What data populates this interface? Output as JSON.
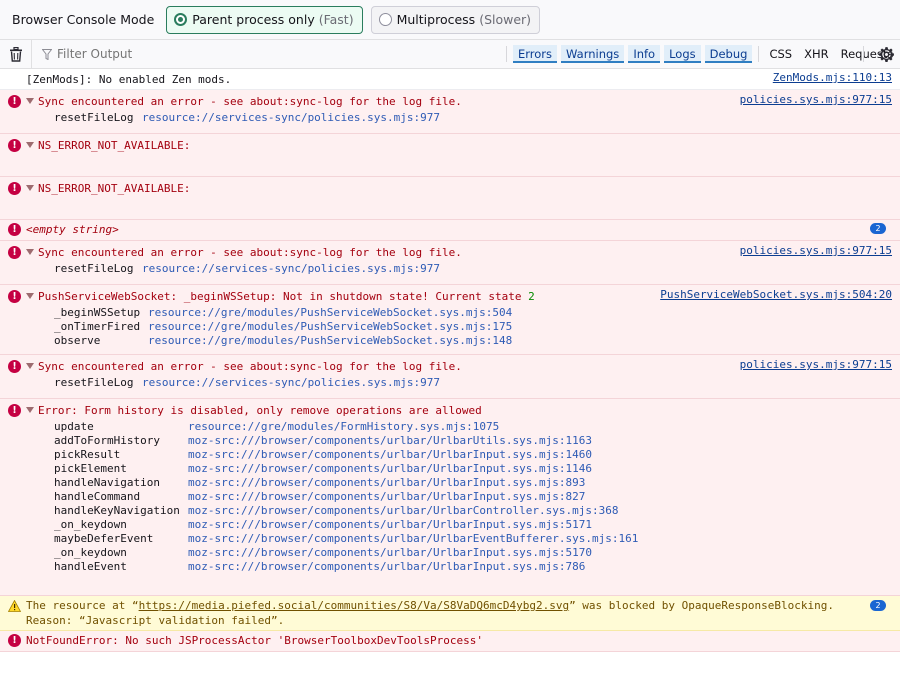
{
  "modebar": {
    "title": "Browser Console Mode",
    "parent_label": "Parent process only",
    "parent_hint": "(Fast)",
    "multi_label": "Multiprocess",
    "multi_hint": "(Slower)"
  },
  "toolbar": {
    "filter_placeholder": "Filter Output",
    "levels": [
      "Errors",
      "Warnings",
      "Info",
      "Logs",
      "Debug"
    ],
    "types": [
      "CSS",
      "XHR",
      "Requests"
    ]
  },
  "messages": {
    "m1": {
      "text": "[ZenMods]: No enabled Zen mods.",
      "source": "ZenMods.mjs:110:13"
    },
    "m2": {
      "text": "Sync encountered an error - see about:sync-log for the log file.",
      "source": "policies.sys.mjs:977:15",
      "frame_fn": "resetFileLog",
      "frame_loc": "resource://services-sync/policies.sys.mjs:977"
    },
    "m3": {
      "text": "NS_ERROR_NOT_AVAILABLE:"
    },
    "m4": {
      "text": "NS_ERROR_NOT_AVAILABLE:"
    },
    "m5": {
      "text": "<empty string>",
      "count": "2"
    },
    "m6": {
      "text": "Sync encountered an error - see about:sync-log for the log file.",
      "source": "policies.sys.mjs:977:15",
      "frame_fn": "resetFileLog",
      "frame_loc": "resource://services-sync/policies.sys.mjs:977"
    },
    "m7": {
      "text": "PushServiceWebSocket: _beginWSSetup: Not in shutdown state! Current state ",
      "state": "2",
      "source": "PushServiceWebSocket.sys.mjs:504:20",
      "frames": [
        {
          "fn": "_beginWSSetup",
          "loc": "resource://gre/modules/PushServiceWebSocket.sys.mjs:504"
        },
        {
          "fn": "_onTimerFired",
          "loc": "resource://gre/modules/PushServiceWebSocket.sys.mjs:175"
        },
        {
          "fn": "observe",
          "loc": "resource://gre/modules/PushServiceWebSocket.sys.mjs:148"
        }
      ]
    },
    "m8": {
      "text": "Sync encountered an error - see about:sync-log for the log file.",
      "source": "policies.sys.mjs:977:15",
      "frame_fn": "resetFileLog",
      "frame_loc": "resource://services-sync/policies.sys.mjs:977"
    },
    "m9": {
      "text": "Error: Form history is disabled, only remove operations are allowed",
      "frames": [
        {
          "fn": "update",
          "loc": "resource://gre/modules/FormHistory.sys.mjs:1075"
        },
        {
          "fn": "addToFormHistory",
          "loc": "moz-src:///browser/components/urlbar/UrlbarUtils.sys.mjs:1163"
        },
        {
          "fn": "pickResult",
          "loc": "moz-src:///browser/components/urlbar/UrlbarInput.sys.mjs:1460"
        },
        {
          "fn": "pickElement",
          "loc": "moz-src:///browser/components/urlbar/UrlbarInput.sys.mjs:1146"
        },
        {
          "fn": "handleNavigation",
          "loc": "moz-src:///browser/components/urlbar/UrlbarInput.sys.mjs:893"
        },
        {
          "fn": "handleCommand",
          "loc": "moz-src:///browser/components/urlbar/UrlbarInput.sys.mjs:827"
        },
        {
          "fn": "handleKeyNavigation",
          "loc": "moz-src:///browser/components/urlbar/UrlbarController.sys.mjs:368"
        },
        {
          "fn": "_on_keydown",
          "loc": "moz-src:///browser/components/urlbar/UrlbarInput.sys.mjs:5171"
        },
        {
          "fn": "maybeDeferEvent",
          "loc": "moz-src:///browser/components/urlbar/UrlbarEventBufferer.sys.mjs:161"
        },
        {
          "fn": "_on_keydown",
          "loc": "moz-src:///browser/components/urlbar/UrlbarInput.sys.mjs:5170"
        },
        {
          "fn": "handleEvent",
          "loc": "moz-src:///browser/components/urlbar/UrlbarInput.sys.mjs:786"
        }
      ]
    },
    "m10": {
      "prefix": "The resource at “",
      "url": "https://media.piefed.social/communities/S8/Va/S8VaDQ6mcD4ybg2.svg",
      "suffix": "” was blocked by OpaqueResponseBlocking.",
      "line2": "Reason: “Javascript validation failed”.",
      "count": "2"
    },
    "m11": {
      "text": "NotFoundError: No such JSProcessActor 'BrowserToolboxDevToolsProcess'"
    }
  },
  "colors": {
    "error": "#a4000f",
    "warning": "#715100",
    "accent": "#2a7d5e",
    "link": "#0b3d91"
  }
}
